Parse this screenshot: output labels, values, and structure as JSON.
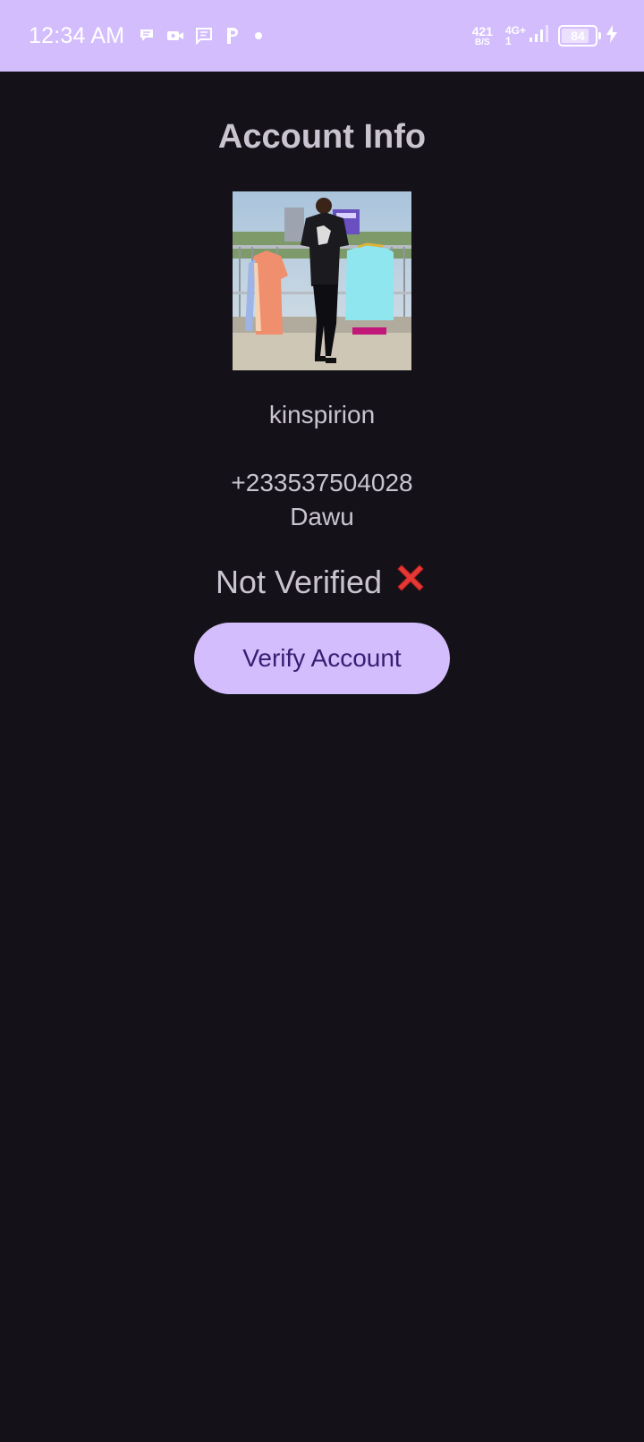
{
  "status_bar": {
    "time": "12:34 AM",
    "net_speed_value": "421",
    "net_speed_unit": "B/S",
    "network_type": "4G+",
    "sim_slot": "1",
    "battery_level": 0.84,
    "battery_label": "84",
    "notification_icons": [
      "chat-bubble-icon",
      "video-call-icon",
      "message-icon",
      "parking-app-icon",
      "dot-icon"
    ],
    "background": "#d3bdfd"
  },
  "page": {
    "title": "Account Info",
    "username": "kinspirion",
    "phone": "+233537504028",
    "location": "Dawu",
    "verification_status": "Not Verified",
    "verification_icon": "cross-mark-icon",
    "verify_button_label": "Verify Account"
  },
  "colors": {
    "background": "#141218",
    "text": "#cac4d0",
    "accent": "#d3bdfd",
    "button_text": "#381e72",
    "error": "#e53935"
  }
}
